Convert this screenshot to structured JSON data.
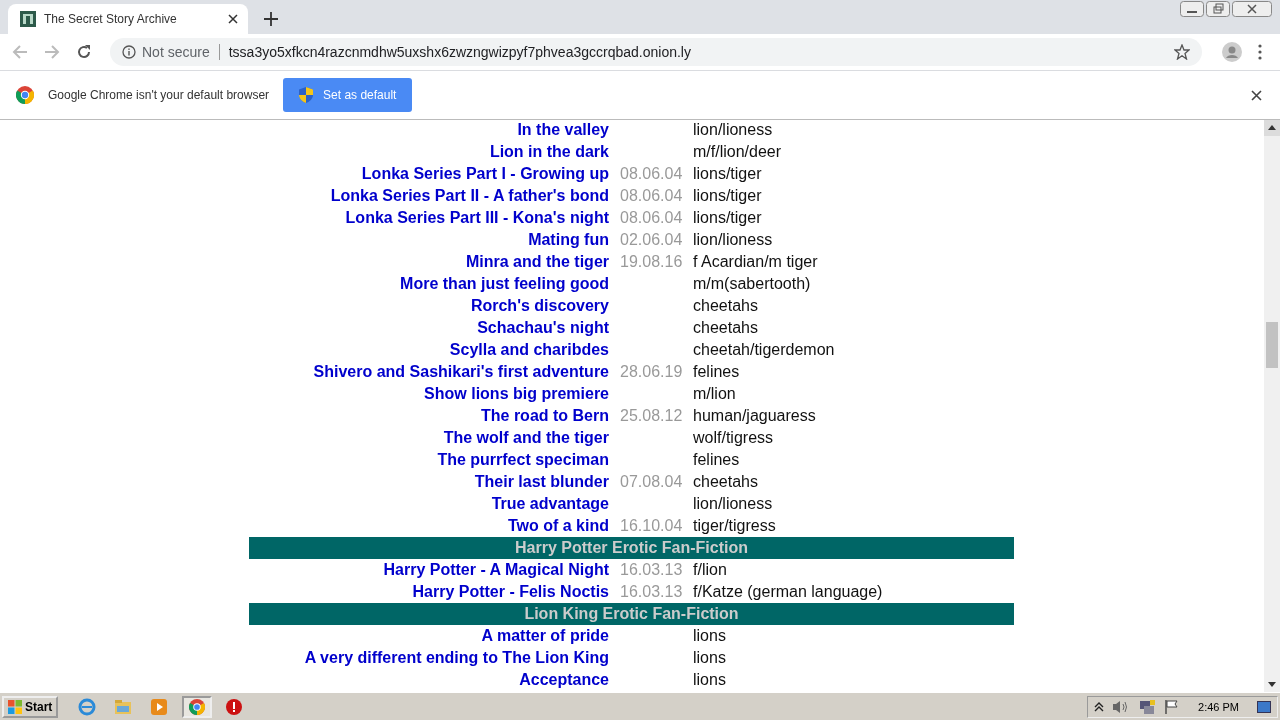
{
  "browser": {
    "tab_title": "The Secret Story Archive",
    "security": "Not secure",
    "url": "tssa3yo5xfkcn4razcnmdhw5uxshx6zwzngwizpyf7phvea3gccrqbad.onion.ly"
  },
  "infobar": {
    "message": "Google Chrome isn't your default browser",
    "button": "Set as default"
  },
  "sections": [
    {
      "stories": [
        {
          "title": "In the valley",
          "tags": "lion/lioness"
        },
        {
          "title": "Lion in the dark",
          "tags": "m/f/lion/deer"
        },
        {
          "title": "Lonka Series Part I - Growing up",
          "date": "08.06.04",
          "tags": "lions/tiger"
        },
        {
          "title": "Lonka Series Part II - A father's bond",
          "date": "08.06.04",
          "tags": "lions/tiger"
        },
        {
          "title": "Lonka Series Part III - Kona's night",
          "date": "08.06.04",
          "tags": "lions/tiger"
        },
        {
          "title": "Mating fun",
          "date": "02.06.04",
          "tags": "lion/lioness"
        },
        {
          "title": "Minra and the tiger",
          "date": "19.08.16",
          "tags": "f Acardian/m tiger"
        },
        {
          "title": "More than just feeling good",
          "tags": "m/m(sabertooth)"
        },
        {
          "title": "Rorch's discovery",
          "tags": "cheetahs"
        },
        {
          "title": "Schachau's night",
          "tags": "cheetahs"
        },
        {
          "title": "Scylla and charibdes",
          "tags": "cheetah/tigerdemon"
        },
        {
          "title": "Shivero and Sashikari's first adventure",
          "date": "28.06.19",
          "tags": "felines"
        },
        {
          "title": "Show lions big premiere",
          "tags": "m/lion"
        },
        {
          "title": "The road to Bern",
          "date": "25.08.12",
          "tags": "human/jaguaress"
        },
        {
          "title": "The wolf and the tiger",
          "tags": "wolf/tigress"
        },
        {
          "title": "The purrfect speciman",
          "tags": "felines"
        },
        {
          "title": "Their last blunder",
          "date": "07.08.04",
          "tags": "cheetahs"
        },
        {
          "title": "True advantage",
          "tags": "lion/lioness"
        },
        {
          "title": "Two of a kind",
          "date": "16.10.04",
          "tags": "tiger/tigress"
        }
      ]
    },
    {
      "heading": "Harry Potter Erotic Fan-Fiction",
      "stories": [
        {
          "title": "Harry Potter - A Magical Night",
          "date": "16.03.13",
          "tags": "f/lion"
        },
        {
          "title": "Harry Potter - Felis Noctis",
          "date": "16.03.13",
          "tags": "f/Katze (german language)"
        }
      ]
    },
    {
      "heading": "Lion King Erotic Fan-Fiction",
      "stories": [
        {
          "title": "A matter of pride",
          "tags": "lions"
        },
        {
          "title": "A very different ending to The Lion King",
          "tags": "lions"
        },
        {
          "title": "Acceptance",
          "tags": "lions"
        }
      ]
    }
  ],
  "taskbar": {
    "start": "Start",
    "clock": "2:46 PM"
  }
}
